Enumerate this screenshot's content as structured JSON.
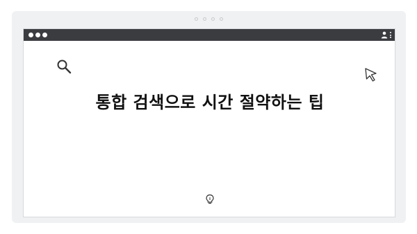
{
  "headline": "통합 검색으로 시간 절약하는 팁",
  "icons": [
    "search-icon",
    "cursor-icon",
    "lightbulb-icon",
    "user-icon",
    "kebab-menu-icon"
  ],
  "colors": {
    "titlebar": "#3a3c40",
    "frame": "#f0f1f3",
    "window": "#ffffff",
    "text": "#111111"
  }
}
